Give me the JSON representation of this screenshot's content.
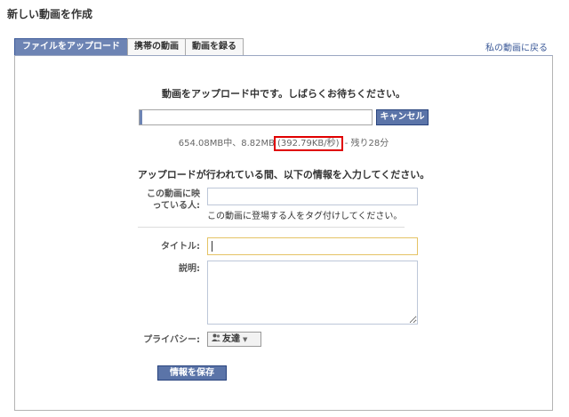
{
  "page": {
    "title": "新しい動画を作成",
    "my_videos_link": "私の動画に戻る"
  },
  "tabs": [
    {
      "label": "ファイルをアップロード",
      "active": true
    },
    {
      "label": "携帯の動画",
      "active": false
    },
    {
      "label": "動画を録る",
      "active": false
    }
  ],
  "upload": {
    "status_text": "動画をアップロード中です。しばらくお待ちください。",
    "cancel_label": "キャンセル",
    "progress_fraction": 0.013,
    "progress_before": "654.08MB中、8.82MB",
    "progress_rate": "(392.79KB/秒)",
    "progress_after": " - 残り28分"
  },
  "form": {
    "heading": "アップロードが行われている間、以下の情報を入力してください。",
    "tag_label_line1": "この動画に映",
    "tag_label_line2": "っている人:",
    "tag_value": "",
    "tag_hint": "この動画に登場する人をタグ付けしてください。",
    "title_label": "タイトル:",
    "title_value": "",
    "description_label": "説明:",
    "description_value": "",
    "privacy_label": "プライバシー:",
    "privacy_value": "友達",
    "save_label": "情報を保存"
  },
  "colors": {
    "accent": "#6d84b4",
    "button": "#5b74a8",
    "highlight": "#e00000",
    "focus_border": "#e5c365"
  },
  "icons": {
    "privacy": "people-icon",
    "dropdown": "chevron-down-icon"
  }
}
